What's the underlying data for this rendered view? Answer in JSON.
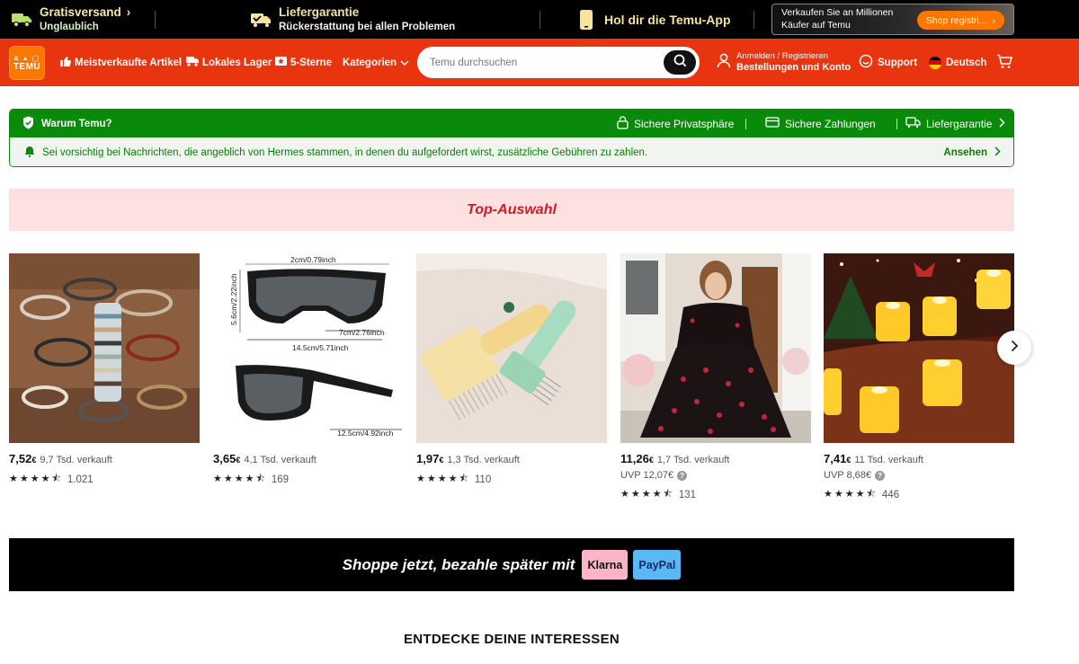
{
  "promo": {
    "shipping_title": "Gratisversand",
    "shipping_sub": "Unglaublich",
    "guarantee_title": "Liefergarantie",
    "guarantee_sub": "Rückerstattung bei allen Problemen",
    "app_label": "Hol dir die Temu-App",
    "sell_line1": "Verkaufen Sie an Millionen",
    "sell_line2": "Käufer auf Temu",
    "sell_button": "Shop registri..."
  },
  "header": {
    "logo_top": "&\\a|O",
    "logo_main": "TEMU",
    "nav": [
      "Meistverkaufte Artikel",
      "Lokales Lager",
      "5-Sterne",
      "Kategorien"
    ],
    "search_placeholder": "Temu durchsuchen",
    "account_line1": "Anmelden / Registrieren",
    "account_line2": "Bestellungen und Konto",
    "support": "Support",
    "language": "Deutsch"
  },
  "why": {
    "title": "Warum Temu?",
    "features": [
      "Sichere Privatsphäre",
      "Sichere Zahlungen",
      "Liefergarantie"
    ],
    "notice": "Sei vorsichtig bei Nachrichten, die angeblich von Hermes stammen, in denen du aufgefordert wirst, zusätzliche Gebühren zu zahlen.",
    "notice_link": "Ansehen"
  },
  "top_selection": {
    "title": "Top-Auswahl",
    "products": [
      {
        "price_main": "7,52",
        "currency": "€",
        "sold": "9,7 Tsd. verkauft",
        "uvp": null,
        "reviews": "1.021",
        "rating": 4.5
      },
      {
        "price_main": "3,65",
        "currency": "€",
        "sold": "4,1 Tsd. verkauft",
        "uvp": null,
        "reviews": "169",
        "rating": 4.5
      },
      {
        "price_main": "1,97",
        "currency": "€",
        "sold": "1,3 Tsd. verkauft",
        "uvp": null,
        "reviews": "110",
        "rating": 4.5
      },
      {
        "price_main": "11,26",
        "currency": "€",
        "sold": "1,7 Tsd. verkauft",
        "uvp": "UVP 12,07€",
        "reviews": "131",
        "rating": 4.5
      },
      {
        "price_main": "7,41",
        "currency": "€",
        "sold": "11 Tsd. verkauft",
        "uvp": "UVP 8,68€",
        "reviews": "446",
        "rating": 4.5
      }
    ],
    "glasses_labels": [
      "2cm/0.79inch",
      "5.6cm/2.22inch",
      "7cm/2.76inch",
      "14.5cm/5.71inch",
      "12.5cm/4.92inch"
    ]
  },
  "pay_banner": {
    "text": "Shoppe jetzt, bezahle später mit",
    "klarna": "Klarna",
    "paypal": "PayPal"
  },
  "discover_title": "ENTDECKE DEINE INTERESSEN",
  "colors": {
    "header_bg": "#e8350f",
    "accent_orange": "#fb7701",
    "why_green": "#0a8a0a",
    "top_pink": "#fde1e1",
    "top_red": "#d11b24"
  }
}
